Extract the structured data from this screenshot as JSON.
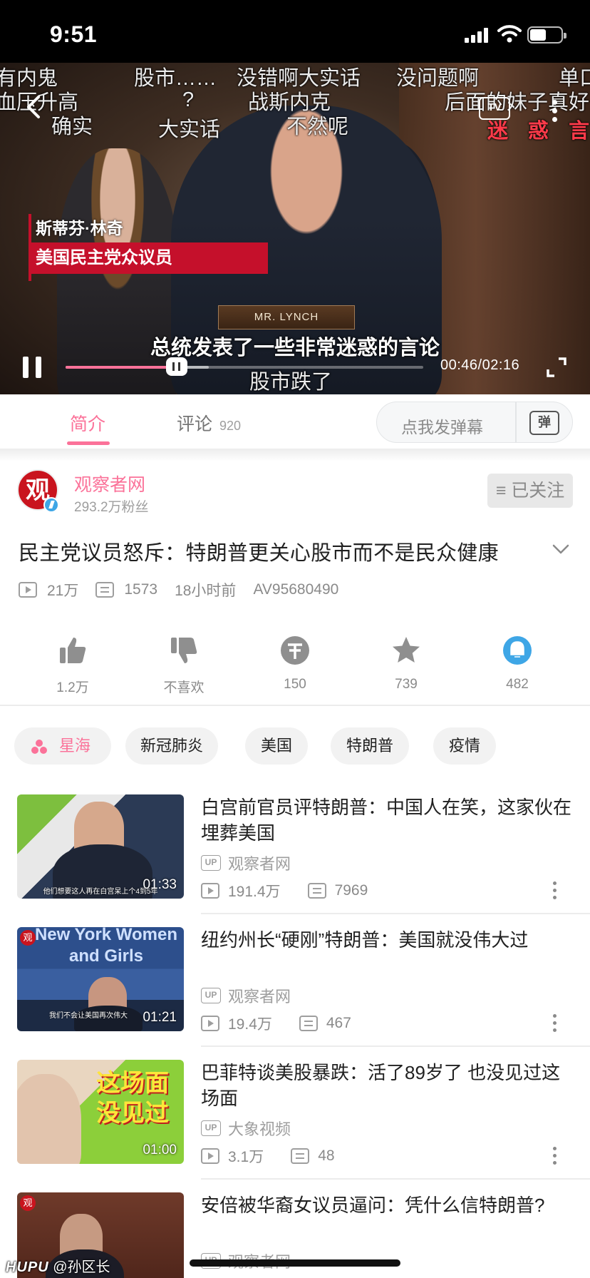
{
  "status_bar": {
    "time": "9:51"
  },
  "player": {
    "danmaku": [
      "有内鬼",
      "股市……",
      "没错啊大实话",
      "没问题啊",
      "单口",
      "血压升高",
      "?",
      "战斯内克",
      "后面的妹子真好",
      "确实",
      "大实话",
      "不然呢",
      "迷 惑 言 论",
      "股市跌了"
    ],
    "lower_third_name": "斯蒂芬·林奇",
    "lower_third_title": "美国民主党众议员",
    "nameplate": "MR. LYNCH",
    "subtitle": "总统发表了一些非常迷惑的言论",
    "current_time": "00:46",
    "duration": "02:16",
    "timecode": "00:46/02:16",
    "progress_played": 0.31,
    "progress_buffered": 0.4,
    "tv_label": "TV"
  },
  "tabs": {
    "intro": "简介",
    "comments": "评论",
    "comment_count": "920",
    "danmaku_placeholder": "点我发弹幕",
    "danmaku_icon_label": "弹"
  },
  "uploader": {
    "avatar_text": "观",
    "name": "观察者网",
    "fans": "293.2万粉丝",
    "follow_label": "≡ 已关注"
  },
  "video": {
    "title": "民主党议员怒斥：特朗普更关心股市而不是民众健康",
    "views": "21万",
    "danmaku_count": "1573",
    "published": "18小时前",
    "av_id": "AV95680490"
  },
  "actions": [
    {
      "icon": "thumbs-up-icon",
      "label": "1.2万"
    },
    {
      "icon": "thumbs-down-icon",
      "label": "不喜欢"
    },
    {
      "icon": "coin-icon",
      "label": "150"
    },
    {
      "icon": "star-icon",
      "label": "739"
    },
    {
      "icon": "share-icon",
      "label": "482"
    }
  ],
  "tags": [
    "星海",
    "新冠肺炎",
    "美国",
    "特朗普",
    "疫情"
  ],
  "recommendations": [
    {
      "title": "白宫前官员评特朗普：中国人在笑，这家伙在埋葬美国",
      "owner": "观察者网",
      "views": "191.4万",
      "danmaku": "7969",
      "duration": "01:33",
      "caption": "他们想要这人再在白宫呆上个4到5年"
    },
    {
      "title": "纽约州长“硬刚”特朗普：美国就没伟大过",
      "owner": "观察者网",
      "views": "19.4万",
      "danmaku": "467",
      "duration": "01:21",
      "caption": "我们不会让美国再次伟大",
      "thumb_text": "New York Women and Girls",
      "badge": "观"
    },
    {
      "title": "巴菲特谈美股暴跌：活了89岁了 也没见过这场面",
      "owner": "大象视频",
      "views": "3.1万",
      "danmaku": "48",
      "duration": "01:00",
      "thumb_text": "这场面 没见过"
    },
    {
      "title": "安倍被华裔女议员逼问：凭什么信特朗普?",
      "owner": "观察者网",
      "badge": "观"
    }
  ],
  "watermark": {
    "brand": "HUPU",
    "handle": "@孙区长"
  },
  "colors": {
    "accent": "#fb7299",
    "danmaku_red": "#ff3b4a",
    "lower_third_red": "#c5102b"
  }
}
